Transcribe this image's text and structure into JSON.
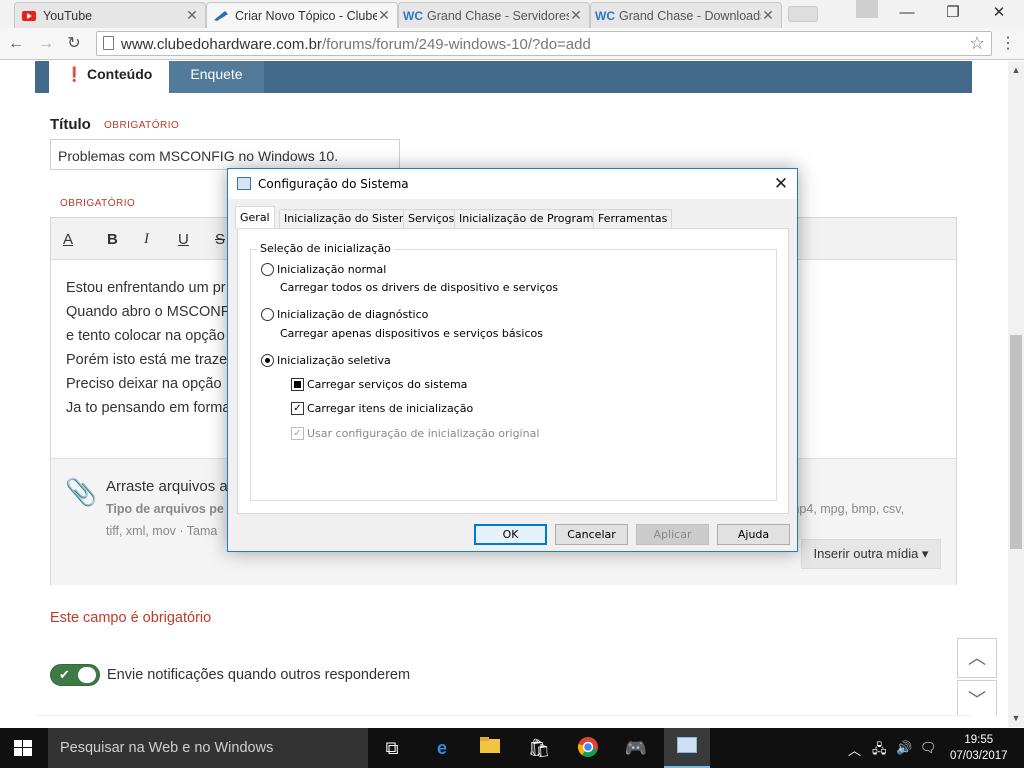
{
  "browser": {
    "tabs": [
      {
        "title": "YouTube",
        "icon": "youtube-icon"
      },
      {
        "title": "Criar Novo Tópico - Clube",
        "icon": "clubedohardware-icon"
      },
      {
        "title": "Grand Chase - Servidores |",
        "icon": "wc-icon"
      },
      {
        "title": "Grand Chase - Downloads",
        "icon": "wc-icon"
      }
    ],
    "url_host": "www.clubedohardware.com.br",
    "url_path": "/forums/forum/249-windows-10/?do=add"
  },
  "page": {
    "tabs": {
      "content": "Conteúdo",
      "poll": "Enquete"
    },
    "title_label": "Título",
    "required": "OBRIGATÓRIO",
    "title_value": "Problemas com MSCONFIG no Windows 10.",
    "editor_buttons": [
      "A",
      "B",
      "I",
      "U",
      "S"
    ],
    "editor_lines": [
      "Estou enfrentando um pr",
      "Quando abro o MSCONF",
      "e tento colocar na opção",
      "Porém isto está me traze",
      "Preciso deixar na opção",
      "Ja to pensando em forma"
    ],
    "upload_drag": "Arraste arquivos a",
    "upload_types": "Tipo de arquivos pe",
    "upload_types_right": "mp4, mpg, bmp, csv,",
    "upload_types_line2": "tiff, xml, mov · Tama",
    "insert_media": "Inserir outra mídia ▾",
    "field_required": "Este campo é obrigatório",
    "notify_label": "Envie notificações quando outros responderem"
  },
  "dialog": {
    "title": "Configuração do Sistema",
    "tabs": [
      "Geral",
      "Inicialização do Sistema",
      "Serviços",
      "Inicialização de Programas",
      "Ferramentas"
    ],
    "group_label": "Seleção de inicialização",
    "option_normal": "Inicialização normal",
    "option_normal_desc": "Carregar todos os drivers de dispositivo e serviços",
    "option_diag": "Inicialização de diagnóstico",
    "option_diag_desc": "Carregar apenas dispositivos e serviços básicos",
    "option_selective": "Inicialização seletiva",
    "chk_services": "Carregar serviços do sistema",
    "chk_startup": "Carregar itens de inicialização",
    "chk_original": "Usar configuração de inicialização original",
    "buttons": {
      "ok": "OK",
      "cancel": "Cancelar",
      "apply": "Aplicar",
      "help": "Ajuda"
    }
  },
  "taskbar": {
    "search_placeholder": "Pesquisar na Web e no Windows",
    "time": "19:55",
    "date": "07/03/2017"
  }
}
